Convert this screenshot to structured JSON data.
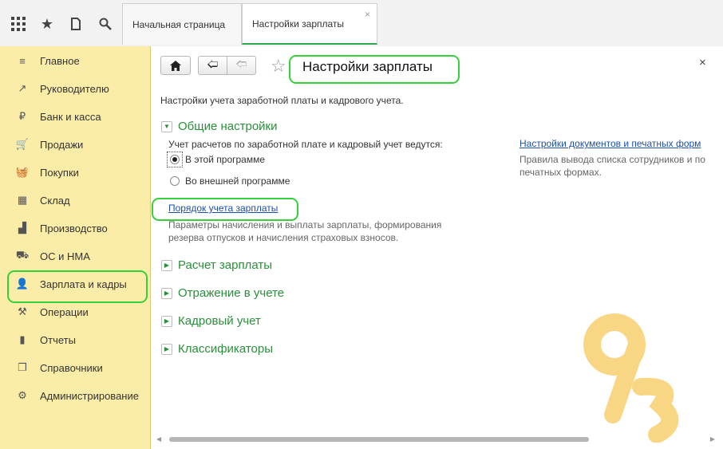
{
  "topbar": {
    "icons": [
      "grid-icon",
      "star-icon",
      "history-icon",
      "search-icon"
    ],
    "tabs": [
      {
        "label": "Начальная страница"
      },
      {
        "label": "Настройки зарплаты",
        "close": "×"
      }
    ]
  },
  "sidebar": {
    "items": [
      {
        "icon": "menu-icon",
        "label": "Главное"
      },
      {
        "icon": "trend-icon",
        "label": "Руководителю"
      },
      {
        "icon": "ruble-icon",
        "label": "Банк и касса"
      },
      {
        "icon": "cart-icon",
        "label": "Продажи"
      },
      {
        "icon": "basket-icon",
        "label": "Покупки"
      },
      {
        "icon": "warehouse-icon",
        "label": "Склад"
      },
      {
        "icon": "factory-icon",
        "label": "Производство"
      },
      {
        "icon": "truck-icon",
        "label": "ОС и НМА"
      },
      {
        "icon": "person-icon",
        "label": "Зарплата и кадры"
      },
      {
        "icon": "operations-icon",
        "label": "Операции"
      },
      {
        "icon": "bar-chart-icon",
        "label": "Отчеты"
      },
      {
        "icon": "book-icon",
        "label": "Справочники"
      },
      {
        "icon": "gear-icon",
        "label": "Администрирование"
      }
    ]
  },
  "main": {
    "title": "Настройки зарплаты",
    "close": "×",
    "description": "Настройки учета заработной платы и кадрового учета.",
    "general": {
      "label": "Общие настройки",
      "question": "Учет расчетов по заработной плате и кадровый учет ведутся:",
      "options": [
        {
          "label": "В этой программе",
          "selected": true
        },
        {
          "label": "Во внешней программе",
          "selected": false
        }
      ],
      "payroll_link": "Порядок учета зарплаты",
      "payroll_desc_1": "Параметры начисления и выплаты зарплаты, формирования",
      "payroll_desc_2": "резерва отпусков и начисления страховых взносов.",
      "docs_link": "Настройки документов и печатных форм",
      "docs_desc_1": "Правила вывода списка сотрудников и по",
      "docs_desc_2": "печатных формах."
    },
    "groups": [
      {
        "label": "Расчет зарплаты"
      },
      {
        "label": "Отражение в учете"
      },
      {
        "label": "Кадровый учет"
      },
      {
        "label": "Классификаторы"
      }
    ]
  },
  "colors": {
    "sidebar_bg": "#fbeda8",
    "accent_green": "#2a8f3a",
    "highlight": "#35d03a",
    "link": "#1e4fa8"
  }
}
